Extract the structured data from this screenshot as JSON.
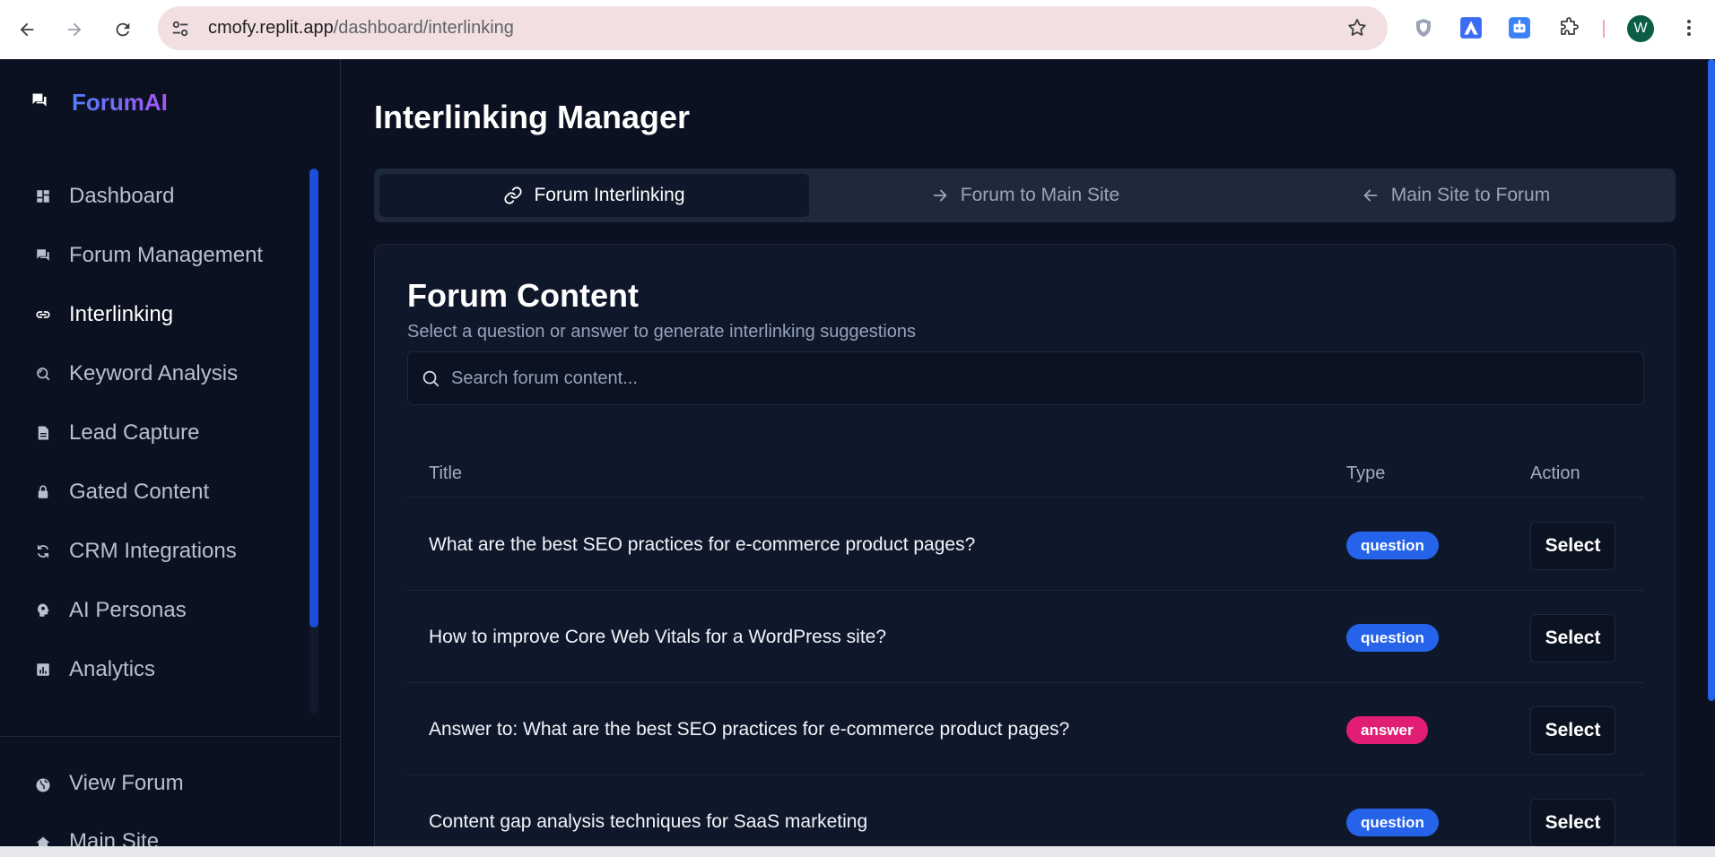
{
  "browser": {
    "url_host": "cmofy.replit.app",
    "url_path": "/dashboard/interlinking",
    "profile_initial": "W"
  },
  "sidebar": {
    "brand": "ForumAI",
    "items": [
      {
        "label": "Dashboard",
        "icon": "dashboard-icon"
      },
      {
        "label": "Forum Management",
        "icon": "forum-icon"
      },
      {
        "label": "Interlinking",
        "icon": "link-icon",
        "active": true
      },
      {
        "label": "Keyword Analysis",
        "icon": "keyword-search-icon"
      },
      {
        "label": "Lead Capture",
        "icon": "document-icon"
      },
      {
        "label": "Gated Content",
        "icon": "lock-icon"
      },
      {
        "label": "CRM Integrations",
        "icon": "sync-icon"
      },
      {
        "label": "AI Personas",
        "icon": "persona-icon"
      },
      {
        "label": "Analytics",
        "icon": "analytics-icon"
      }
    ],
    "bottom_items": [
      {
        "label": "View Forum",
        "icon": "globe-icon"
      },
      {
        "label": "Main Site",
        "icon": "home-icon"
      }
    ]
  },
  "main": {
    "title": "Interlinking Manager",
    "tabs": [
      {
        "label": "Forum Interlinking",
        "icon": "link-icon",
        "active": true
      },
      {
        "label": "Forum to Main Site",
        "icon": "arrow-right-icon"
      },
      {
        "label": "Main Site to Forum",
        "icon": "arrow-left-icon"
      }
    ],
    "card": {
      "title": "Forum Content",
      "subtitle": "Select a question or answer to generate interlinking suggestions",
      "search_placeholder": "Search forum content...",
      "columns": [
        "Title",
        "Type",
        "Action"
      ],
      "rows": [
        {
          "title": "What are the best SEO practices for e-commerce product pages?",
          "type": "question",
          "action": "Select"
        },
        {
          "title": "How to improve Core Web Vitals for a WordPress site?",
          "type": "question",
          "action": "Select"
        },
        {
          "title": "Answer to: What are the best SEO practices for e-commerce product pages?",
          "type": "answer",
          "action": "Select"
        },
        {
          "title": "Content gap analysis techniques for SaaS marketing",
          "type": "question",
          "action": "Select"
        }
      ]
    }
  },
  "colors": {
    "question_badge": "#2563eb",
    "answer_badge": "#e11d74",
    "accent": "#1d4ed8",
    "background": "#0b1120"
  }
}
